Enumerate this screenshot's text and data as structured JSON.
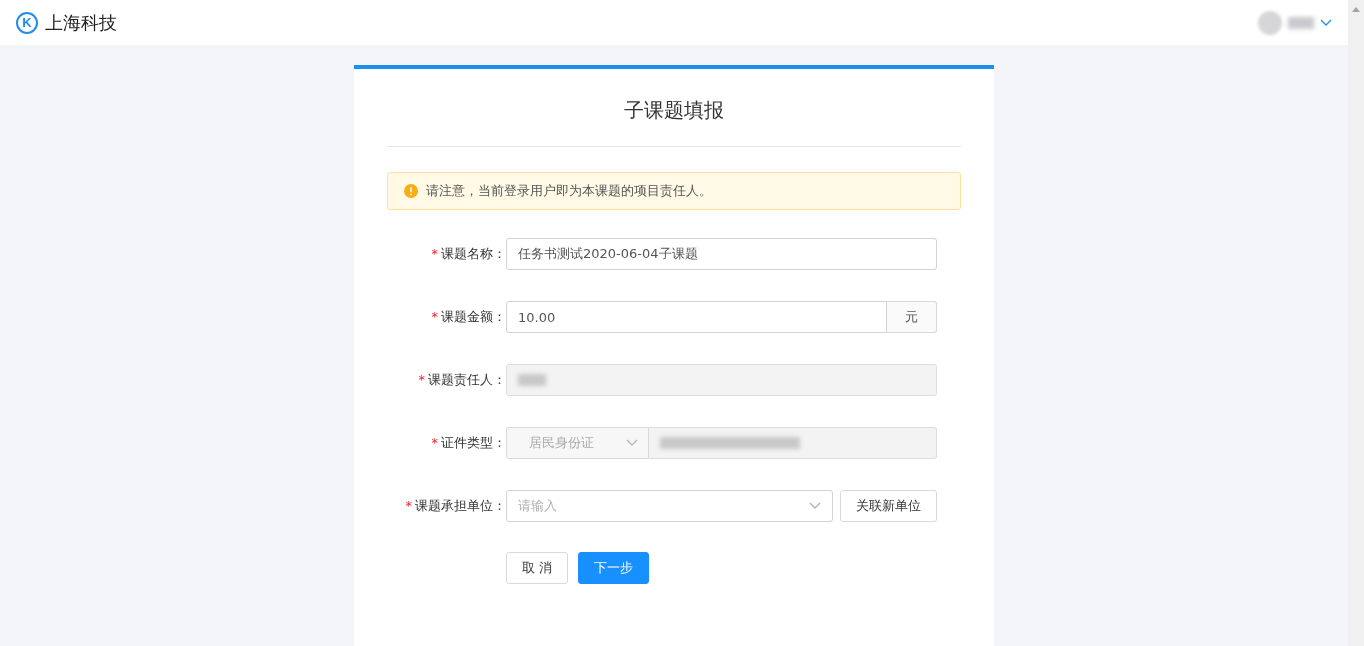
{
  "header": {
    "logo_letter": "K",
    "brand": "上海科技"
  },
  "form": {
    "title": "子课题填报",
    "notice": "请注意，当前登录用户即为本课题的项目责任人。",
    "fields": [
      {
        "kind": "text",
        "required_mark": "*",
        "label": "课题名称：",
        "value": "任务书测试2020-06-04子课题",
        "disabled": false
      },
      {
        "kind": "amount",
        "required_mark": "*",
        "label": "课题金额：",
        "value": "10.00",
        "suffix": "元",
        "disabled": false
      },
      {
        "kind": "redacted",
        "required_mark": "*",
        "label": "课题责任人：",
        "disabled": true
      },
      {
        "kind": "id",
        "required_mark": "*",
        "label": "证件类型：",
        "select_value": "居民身份证",
        "disabled": true
      },
      {
        "kind": "select",
        "required_mark": "*",
        "label": "课题承担单位：",
        "placeholder": "请输入",
        "button": "关联新单位",
        "disabled": false
      }
    ],
    "buttons": [
      {
        "kind": "default",
        "label": "取 消"
      },
      {
        "kind": "primary",
        "label": "下一步"
      }
    ]
  }
}
